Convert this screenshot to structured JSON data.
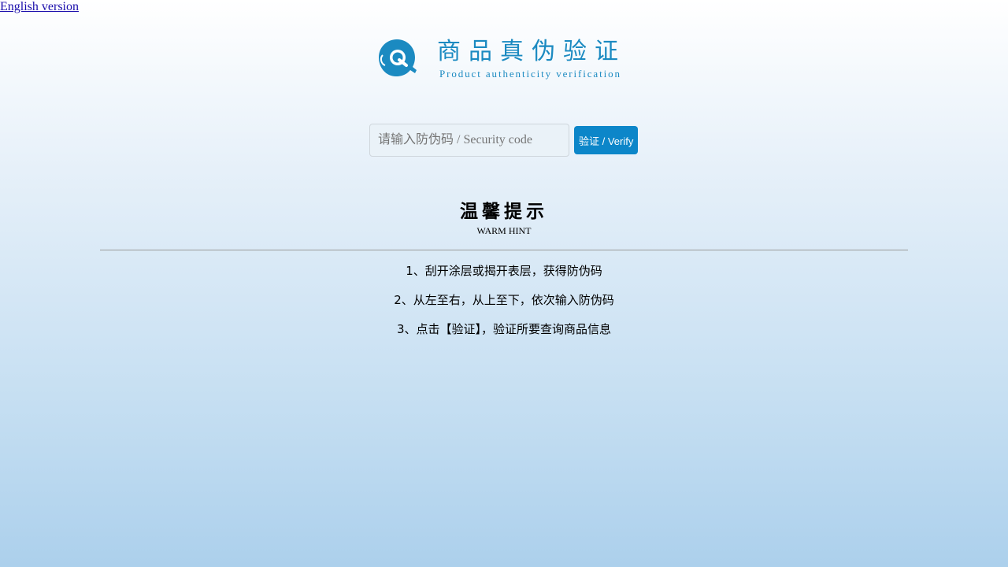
{
  "header": {
    "lang_link": "English version"
  },
  "logo": {
    "title_cn": "商品真伪验证",
    "title_en": "Product authenticity verification",
    "mark_icon": "q-logo-icon",
    "color": "#1b8ac1"
  },
  "search": {
    "placeholder": "请输入防伪码 / Security code",
    "value": "",
    "button_label": "验证 / Verify",
    "button_color": "#0c86c9"
  },
  "hint": {
    "title": "温馨提示",
    "subtitle": "WARM HINT",
    "steps": [
      "1、刮开涂层或揭开表层，获得防伪码",
      "2、从左至右，从上至下，依次输入防伪码",
      "3、点击【验证】，验证所要查询商品信息"
    ]
  }
}
